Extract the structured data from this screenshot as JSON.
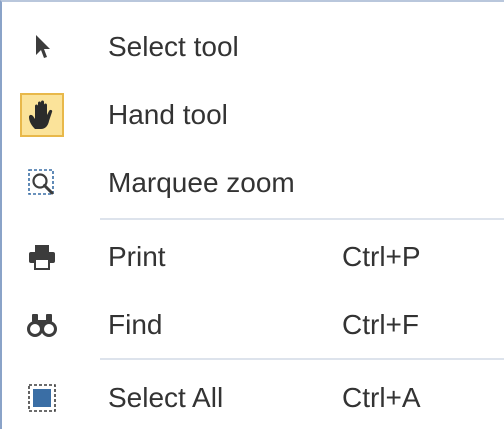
{
  "menu": {
    "items": [
      {
        "label": "Select tool",
        "icon": "arrow-cursor-icon",
        "checked": false
      },
      {
        "label": "Hand tool",
        "icon": "hand-icon",
        "checked": true
      },
      {
        "label": "Marquee zoom",
        "icon": "marquee-zoom-icon",
        "checked": false
      },
      {
        "label": "Print",
        "shortcut": "Ctrl+P",
        "icon": "printer-icon",
        "checked": false
      },
      {
        "label": "Find",
        "shortcut": "Ctrl+F",
        "icon": "binoculars-icon",
        "checked": false
      },
      {
        "label": "Select All",
        "shortcut": "Ctrl+A",
        "icon": "select-all-icon",
        "checked": false
      }
    ]
  },
  "colors": {
    "checked_background": "#fbe39a",
    "checked_border": "#e8b84a",
    "menu_border": "#8aa3c8",
    "separator": "#dde3ec",
    "icon_dark": "#3c3c3c",
    "select_all_fill": "#3a6ea5"
  }
}
